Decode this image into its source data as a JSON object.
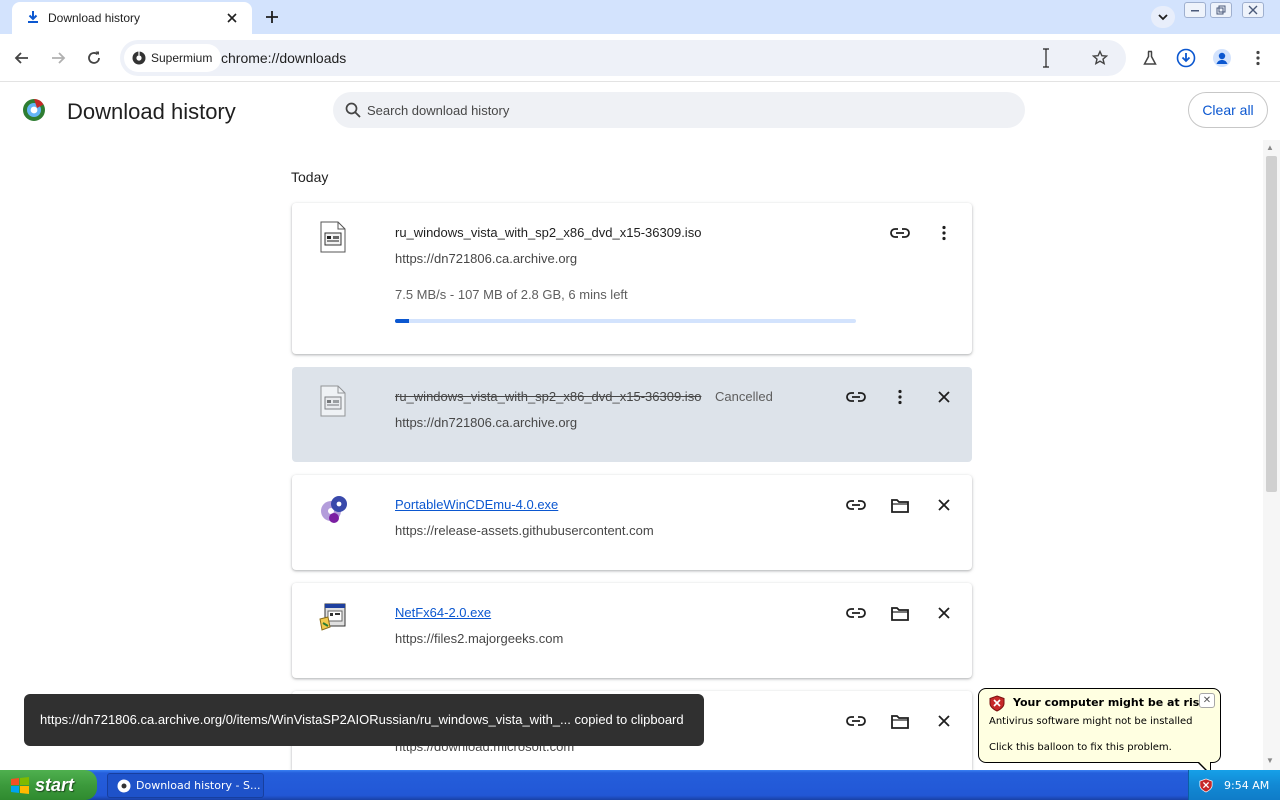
{
  "tab": {
    "title": "Download history",
    "icon": "download-icon"
  },
  "toolbar": {
    "site_chip": "Supermium",
    "url": "chrome://downloads"
  },
  "page": {
    "title": "Download history",
    "search_placeholder": "Search download history",
    "clear_all": "Clear all",
    "section_label": "Today"
  },
  "downloads": [
    {
      "filename": "ru_windows_vista_with_sp2_x86_dvd_x15-36309.iso",
      "url": "https://dn721806.ca.archive.org",
      "progress_text": "7.5 MB/s - 107 MB of 2.8 GB, 6 mins left",
      "progress_fraction": 0.03,
      "state": "in-progress"
    },
    {
      "filename": "ru_windows_vista_with_sp2_x86_dvd_x15-36309.iso",
      "url": "https://dn721806.ca.archive.org",
      "status": "Cancelled",
      "state": "cancelled"
    },
    {
      "filename": "PortableWinCDEmu-4.0.exe",
      "url": "https://release-assets.githubusercontent.com",
      "state": "complete"
    },
    {
      "filename": "NetFx64-2.0.exe",
      "url": "https://files2.majorgeeks.com",
      "state": "complete"
    },
    {
      "url": "https://download.microsoft.com",
      "state": "complete"
    }
  ],
  "toast": {
    "message": "https://dn721806.ca.archive.org/0/items/WinVistaSP2AIORussian/ru_windows_vista_with_...  copied to clipboard"
  },
  "balloon": {
    "title": "Your computer might be at risk",
    "line1": "Antivirus software might not be installed",
    "line2": "Click this balloon to fix this problem."
  },
  "taskbar": {
    "start_label": "start",
    "task_label": "Download history - S...",
    "clock": "9:54 AM"
  },
  "colors": {
    "accent": "#0b57d0",
    "tabstrip": "#d3e3fd",
    "cancelled_card": "#dde3ea",
    "toast_bg": "#303030",
    "balloon_bg": "#ffffe1"
  }
}
